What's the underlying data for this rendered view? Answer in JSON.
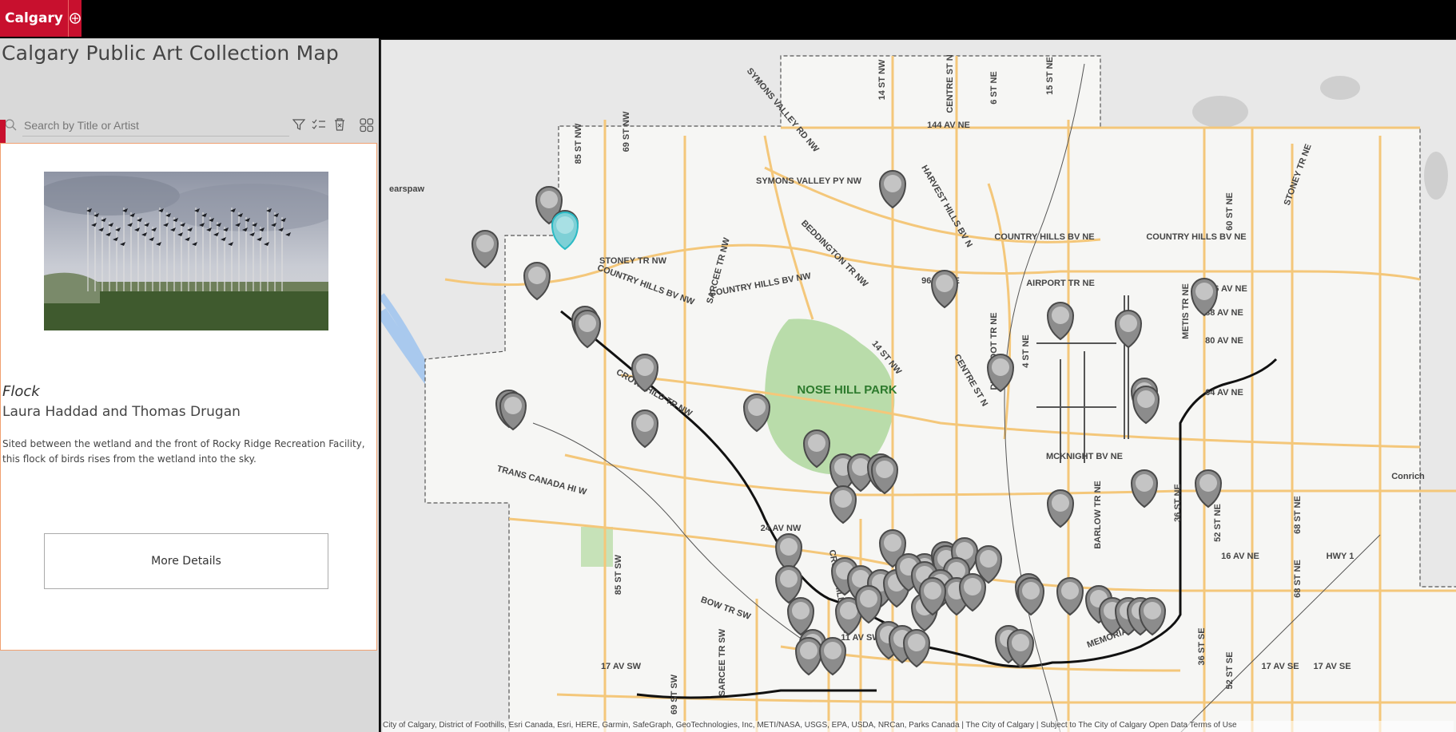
{
  "header": {
    "brand": "Calgary"
  },
  "sidebar": {
    "app_title": "Calgary Public Art Collection Map",
    "search_placeholder": "Search by Title or Artist",
    "tools": [
      "filter-icon",
      "list-check-icon",
      "clear-icon",
      "grid-icon"
    ]
  },
  "feature": {
    "title": "Flock",
    "artist": "Laura Haddad and Thomas Drugan",
    "description": "Sited between the wetland and the front of Rocky Ridge Recreation Facility, this flock of birds rises from the wetland into the sky.",
    "details_label": "More Details"
  },
  "map": {
    "park_label": "NOSE HILL PARK",
    "labels": [
      "14 ST NW",
      "CENTRE ST N",
      "6 ST NE",
      "15 ST NE",
      "SYMONS VALLEY RD NW",
      "85 ST NW",
      "69 ST NW",
      "144 AV NE",
      "SYMONS VALLEY PY NW",
      "HARVEST HILLS BV N",
      "COUNTRY HILLS BV NE",
      "COUNTRY HILLS BV NE",
      "60 ST NE",
      "STONEY TR NE",
      "STONEY TR NW",
      "SARCEE TR NW",
      "BEDDINGTON TR NW",
      "96 AV NE",
      "AIRPORT TR NE",
      "96 AV NE",
      "COUNTRY HILLS BV NW",
      "COUNTRY HILLS BV NW",
      "METIS TR NE",
      "88 AV NE",
      "80 AV NE",
      "DEERFOOT TR NE",
      "14 ST NW",
      "CENTRE ST N",
      "4 ST NE",
      "64 AV NE",
      "CROWCHILD TR NW",
      "MCKNIGHT BV NE",
      "TRANS CANADA HI W",
      "24 AV NW",
      "36 ST NE",
      "BARLOW TR NE",
      "52 ST NE",
      "68 ST NE",
      "16 AV NE",
      "HWY 1",
      "CROWCHILD TR SW",
      "BOW TR SW",
      "85 ST SW",
      "11 AV SW",
      "MEMORIAL DR SE",
      "36 ST SE",
      "52 ST SE",
      "17 AV SW",
      "SARCEE TR SW",
      "69 ST SW",
      "17 AV SE",
      "17 AV SE",
      "Conrich",
      "earspaw",
      "68 ST NE"
    ],
    "attribution": "City of Calgary, District of Foothills, Esri Canada, Esri, HERE, Garmin, SafeGraph, GeoTechnologies, Inc, METI/NASA, USGS, EPA, USDA, NRCan, Parks Canada | The City of Calgary | Subject to The City of Calgary Open Data Terms of Use"
  }
}
